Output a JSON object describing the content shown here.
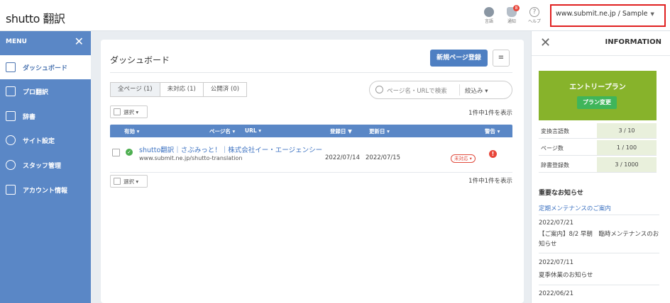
{
  "header": {
    "logo": "shutto 翻訳",
    "icons": [
      {
        "name": "globe-icon",
        "label": "言語"
      },
      {
        "name": "bell-icon",
        "label": "通知",
        "badge": "8"
      },
      {
        "name": "help-icon",
        "label": "ヘルプ",
        "glyph": "?"
      }
    ],
    "site_select": "www.submit.ne.jp / Sample"
  },
  "sidebar": {
    "title": "MENU",
    "close_glyph": "✕",
    "items": [
      {
        "label": "ダッシュボード",
        "icon": "home-icon",
        "active": true
      },
      {
        "label": "プロ翻訳",
        "icon": "grid-icon",
        "active": false
      },
      {
        "label": "辞書",
        "icon": "book-icon",
        "active": false
      },
      {
        "label": "サイト設定",
        "icon": "gear-icon",
        "active": false
      },
      {
        "label": "スタッフ管理",
        "icon": "users-icon",
        "active": false
      },
      {
        "label": "アカウント情報",
        "icon": "document-icon",
        "active": false
      }
    ]
  },
  "main": {
    "title": "ダッシュボード",
    "new_button": "新規ページ登録",
    "menu_button": "≡",
    "tabs": [
      "全ページ (1)",
      "未対応 (1)",
      "公開済 (0)"
    ],
    "search_placeholder": "ページ名・URLで検索",
    "filter_label": "絞込み ▾",
    "select_label": "選択 ▾",
    "count_text": "1件中1件を表示",
    "columns": [
      "有効 ▾",
      "ページ名 ▾",
      "URL ▾",
      "登録日 ▼",
      "更新日 ▾",
      "警告 ▾"
    ],
    "rows": [
      {
        "name": "shutto翻訳｜さぶみっと！｜株式会社イー・エージェンシー",
        "url": "www.submit.ne.jp/shutto-translation",
        "registered": "2022/07/14",
        "updated": "2022/07/15",
        "status": "未対応 ▾",
        "warning": "!"
      }
    ]
  },
  "info": {
    "close_glyph": "✕",
    "title": "INFORMATION",
    "plan_name": "エントリープラン",
    "plan_button": "プラン変更",
    "stats": [
      {
        "label": "変換言語数",
        "value": "3 / 10"
      },
      {
        "label": "ページ数",
        "value": "1 / 100"
      },
      {
        "label": "辞書登録数",
        "value": "3 / 1000"
      }
    ],
    "news_heading": "重要なお知らせ",
    "news_link": "定期メンテナンスのご案内",
    "news": [
      {
        "date": "2022/07/21",
        "text": "【ご案内】8/2 早朝　臨時メンテナンスのお知らせ"
      },
      {
        "date": "2022/07/11",
        "text": "夏季休業のお知らせ"
      },
      {
        "date": "2022/06/21",
        "text": ""
      }
    ]
  }
}
